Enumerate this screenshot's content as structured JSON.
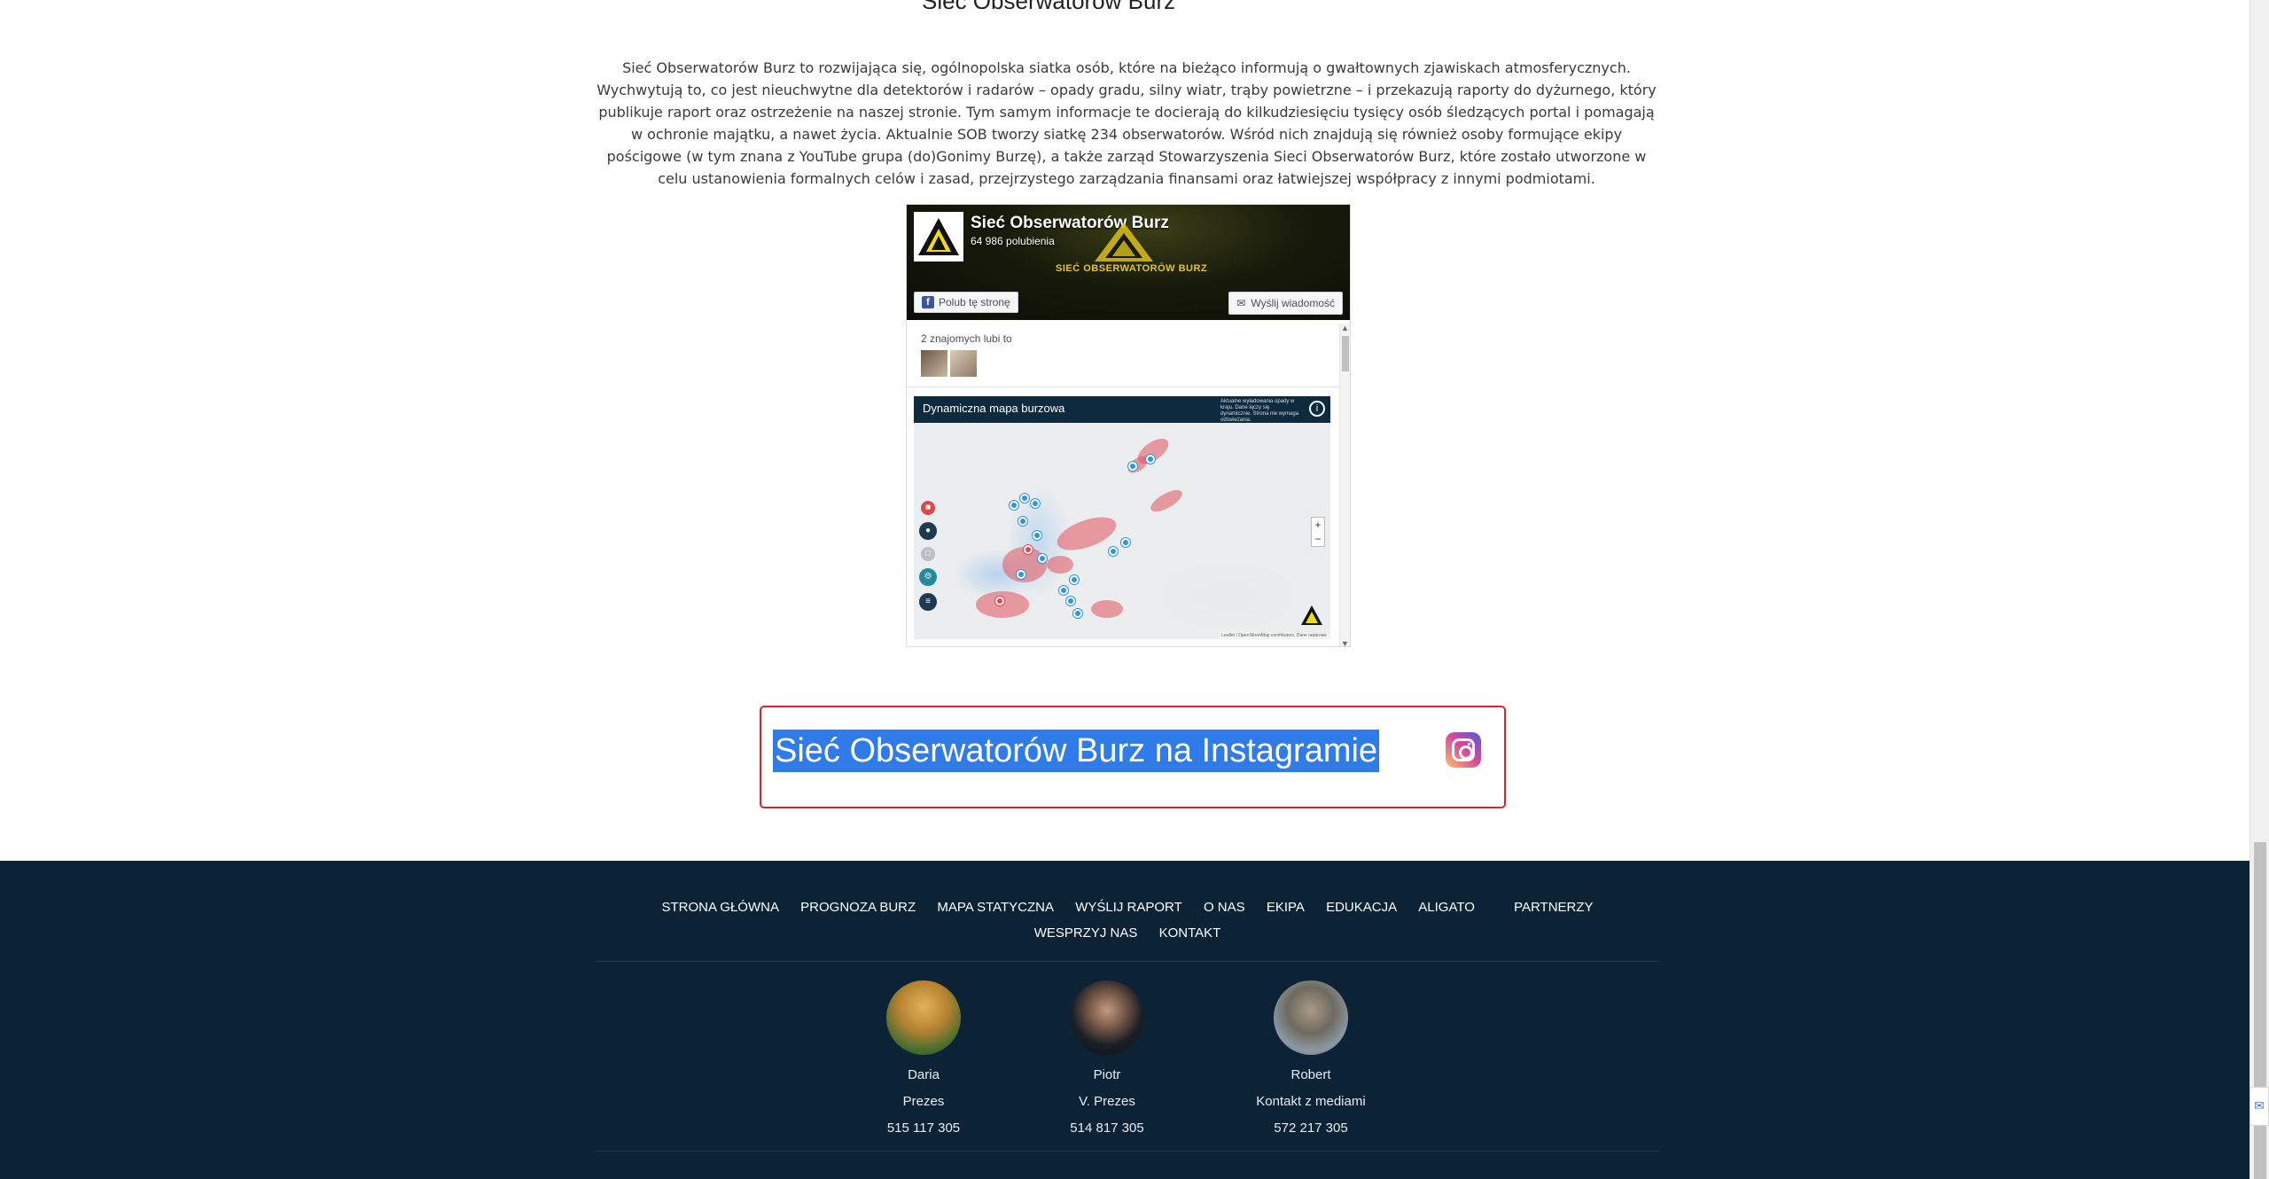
{
  "top_heading": "Sieć Obserwatorów Burz",
  "intro_text": "Sieć Obserwatorów Burz to rozwijająca się, ogólnopolska siatka osób, które na bieżąco informują o gwałtownych zjawiskach atmosferycznych. Wychwytują to, co jest nieuchwytne dla detektorów i radarów – opady gradu, silny wiatr, trąby powietrzne – i przekazują raporty do dyżurnego, który publikuje raport oraz ostrzeżenie na naszej stronie. Tym samym informacje te docierają do kilkudziesięciu tysięcy osób śledzących portal i pomagają w ochronie majątku, a nawet życia. Aktualnie SOB tworzy siatkę 234 obserwatorów. Wśród nich znajdują się również osoby formujące ekipy pościgowe (w tym znana z YouTube grupa (do)Gonimy Burzę), a także zarząd Stowarzyszenia Sieci Obserwatorów Burz, które zostało utworzone w celu ustanowienia formalnych celów i zasad, przejrzystego zarządzania finansami oraz łatwiejszej współpracy z innymi podmiotami.",
  "facebook": {
    "page_name": "Sieć Obserwatorów Burz",
    "likes": "64 986 polubienia",
    "brand_text": "SIEĆ OBSERWATORÓW BURZ",
    "like_button": "Polub tę stronę",
    "message_button": "Wyślij wiadomość",
    "friends_text": "2 znajomych lubi to",
    "post_title": "Dynamiczna mapa burzowa",
    "map_info": "Aktualne wyładowania opady w kraju. Dane łączy się dynamicznie. Strona nie wymaga odświeżania.",
    "map_attribution": "Leaflet | OpenStreetMap contributors, Dane radarowe"
  },
  "instagram": {
    "link_text": "Sieć Obserwatorów Burz na Instagramie",
    "icon": "instagram-icon"
  },
  "footer": {
    "nav": [
      "STRONA GŁÓWNA",
      "PROGNOZA BURZ",
      "MAPA STATYCZNA",
      "WYŚLIJ RAPORT",
      "O NAS",
      "EKIPA",
      "EDUKACJA",
      "ALIGATO",
      "PARTNERZY",
      "WESPRZYJ NAS",
      "KONTAKT"
    ],
    "people": [
      {
        "name": "Daria",
        "role": "Prezes",
        "phone": "515 117 305"
      },
      {
        "name": "Piotr",
        "role": "V. Prezes",
        "phone": "514 817 305"
      },
      {
        "name": "Robert",
        "role": "Kontakt z mediami",
        "phone": "572 217 305"
      }
    ]
  },
  "colors": {
    "footer_bg": "#0c2235",
    "highlight": "#2f7bea",
    "box_border": "#d9232b"
  }
}
